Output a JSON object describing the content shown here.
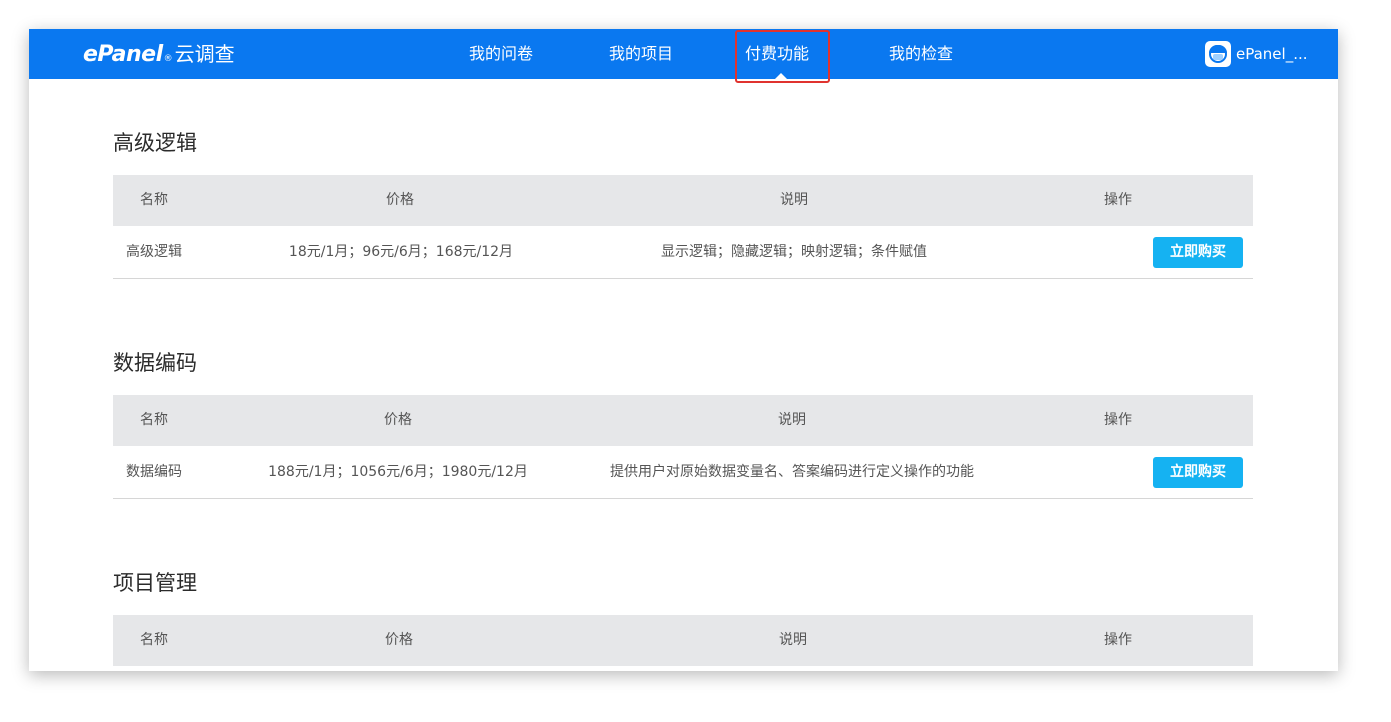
{
  "app": {
    "logo_brand": "ePanel",
    "logo_dot": "®",
    "logo_name": "云调查"
  },
  "nav": {
    "items": [
      {
        "label": "我的问卷"
      },
      {
        "label": "我的项目"
      },
      {
        "label": "付费功能",
        "active": true
      },
      {
        "label": "我的检查"
      }
    ],
    "user_name": "ePanel_..."
  },
  "table_headers": {
    "name": "名称",
    "price": "价格",
    "desc": "说明",
    "action": "操作"
  },
  "sections": [
    {
      "title": "高级逻辑",
      "rows": [
        {
          "name": "高级逻辑",
          "price": "18元/1月；96元/6月；168元/12月",
          "desc": "显示逻辑；隐藏逻辑；映射逻辑；条件赋值",
          "button": "立即购买"
        }
      ]
    },
    {
      "title": "数据编码",
      "rows": [
        {
          "name": "数据编码",
          "price": "188元/1月；1056元/6月；1980元/12月",
          "desc": "提供用户对原始数据变量名、答案编码进行定义操作的功能",
          "button": "立即购买"
        }
      ]
    },
    {
      "title": "项目管理",
      "rows": []
    }
  ],
  "colors": {
    "topbar": "#0a78f0",
    "active_highlight": "#e0332f",
    "buy_button": "#15b2f2",
    "table_header_bg": "#e6e7e9"
  }
}
